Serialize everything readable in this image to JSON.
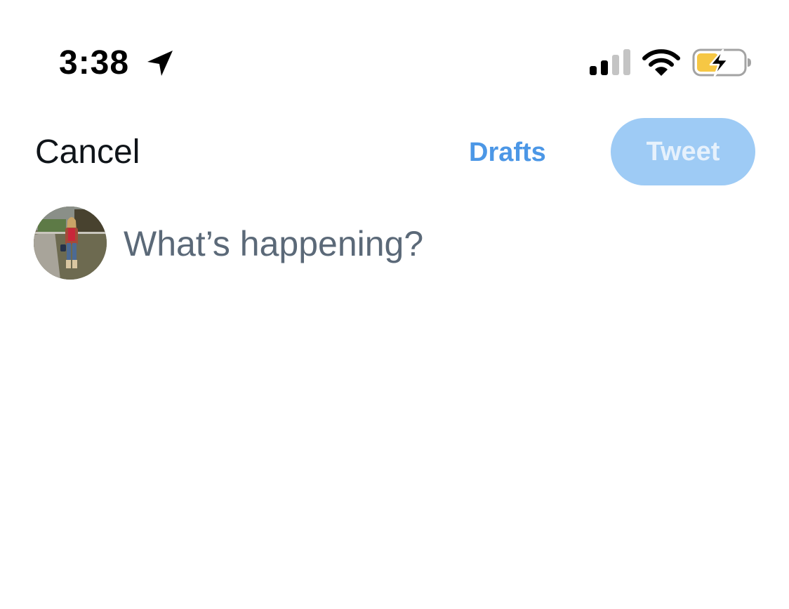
{
  "status_bar": {
    "time": "3:38",
    "icons": [
      "location-arrow-icon",
      "cellular-signal-icon",
      "wifi-icon",
      "battery-charging-icon"
    ]
  },
  "compose": {
    "cancel_label": "Cancel",
    "drafts_label": "Drafts",
    "tweet_label": "Tweet",
    "input_placeholder": "What’s happening?",
    "input_value": ""
  },
  "colors": {
    "accent": "#4c97e6",
    "tweet_button_disabled": "#9ecbf5",
    "placeholder_text": "#5b6978",
    "battery_fill": "#f6c744"
  }
}
